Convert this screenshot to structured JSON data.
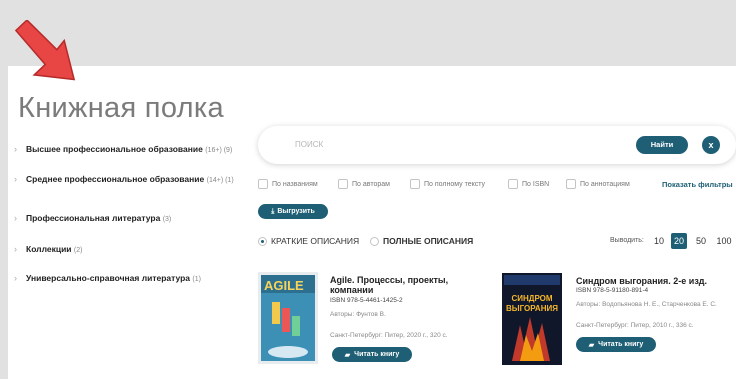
{
  "page_title": "Книжная полка",
  "categories": [
    {
      "name": "Высшее профессиональное образование",
      "count": "(16+) (9)"
    },
    {
      "name": "Среднее профессиональное образование",
      "count": "(14+) (1)"
    },
    {
      "name": "Профессиональная литература",
      "count": "(3)"
    },
    {
      "name": "Коллекции",
      "count": "(2)"
    },
    {
      "name": "Универсально-справочная литература",
      "count": "(1)"
    }
  ],
  "search": {
    "placeholder": "ПОИСК",
    "find_label": "Найти",
    "clear_label": "x"
  },
  "filters": [
    "По названиям",
    "По авторам",
    "По полному тексту",
    "По ISBN",
    "По аннотациям"
  ],
  "show_filters_label": "Показать фильтры",
  "export_label": "Выгрузить",
  "view_modes": [
    "КРАТКИЕ ОПИСАНИЯ",
    "ПОЛНЫЕ ОПИСАНИЯ"
  ],
  "output_label": "Выводить:",
  "per_page": [
    "10",
    "20",
    "50",
    "100"
  ],
  "per_page_selected": "20",
  "books": [
    {
      "title_line1": "Agile. Процессы, проекты,",
      "title_line2": "компании",
      "isbn": "ISBN 978-5-4461-1425-2",
      "authors": "Авторы: Фунтов В.",
      "publisher": "Санкт-Петербург: Питер, 2020 г., 320 с.",
      "read_label": "Читать книгу",
      "cover_text": "AGILE"
    },
    {
      "title_line1": "Синдром выгорания. 2-е изд.",
      "isbn": "ISBN 978-5-91180-891-4",
      "authors": "Авторы: Водопьянова Н. Е., Старченкова Е. С.",
      "publisher": "Санкт-Петербург: Питер, 2010 г., 336 с.",
      "read_label": "Читать книгу",
      "cover_text_1": "СИНДРОМ",
      "cover_text_2": "ВЫГОРАНИЯ"
    }
  ],
  "colors": {
    "accent": "#1e5f75",
    "arrow": "#e84545",
    "background": "#e1e1e1"
  }
}
